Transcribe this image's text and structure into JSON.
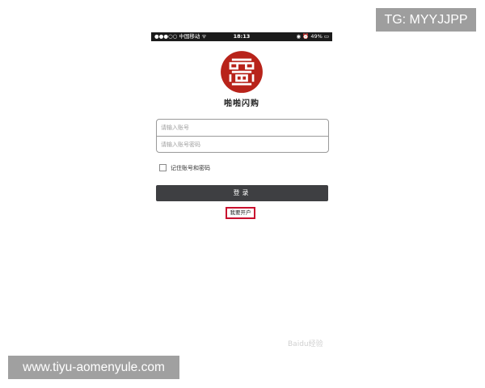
{
  "status_bar": {
    "carrier": "●●●○○ 中国移动 ᯤ",
    "time": "18:13",
    "battery": "◉ ⏰ 49% ▭"
  },
  "app": {
    "name": "啪啪闪购"
  },
  "login_form": {
    "account_placeholder": "请输入账号",
    "password_placeholder": "请输入账号密码",
    "remember_label": "记住账号和密码",
    "remember_checked": false,
    "login_button": "登录",
    "open_account_link": "我要开户"
  },
  "overlays": {
    "tg_label": "TG: MYYJJPP",
    "site_label": "www.tiyu-aomenyule.com",
    "faint_watermark": "Baidu经验"
  },
  "colors": {
    "logo_red": "#b8231a",
    "button_dark": "#3e3f42",
    "link_border": "#c8102e"
  }
}
